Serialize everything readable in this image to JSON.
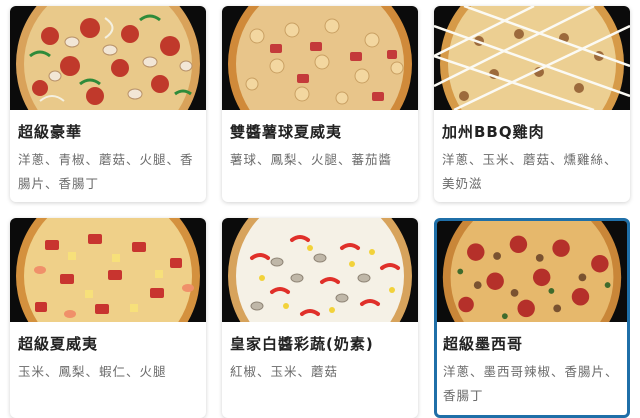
{
  "colors": {
    "selected_border": "#1f6fa8",
    "card_bg": "#ffffff",
    "image_bg": "#0b0b0b",
    "title_text": "#222222",
    "desc_text": "#6b6b6b"
  },
  "pizzas": [
    {
      "name": "超級豪華",
      "ingredients": "洋蔥、青椒、蘑菇、火腿、香腸片、香腸丁",
      "selected": false
    },
    {
      "name": "雙醬薯球夏威夷",
      "ingredients": "薯球、鳳梨、火腿、蕃茄醬",
      "selected": false
    },
    {
      "name": "加州BBQ雞肉",
      "ingredients": "洋蔥、玉米、蘑菇、燻雞絲、美奶滋",
      "selected": false
    },
    {
      "name": "超級夏威夷",
      "ingredients": "玉米、鳳梨、蝦仁、火腿",
      "selected": false
    },
    {
      "name": "皇家白醬彩蔬(奶素)",
      "ingredients": "紅椒、玉米、蘑菇",
      "selected": false
    },
    {
      "name": "超級墨西哥",
      "ingredients": "洋蔥、墨西哥辣椒、香腸片、香腸丁",
      "selected": true
    }
  ]
}
